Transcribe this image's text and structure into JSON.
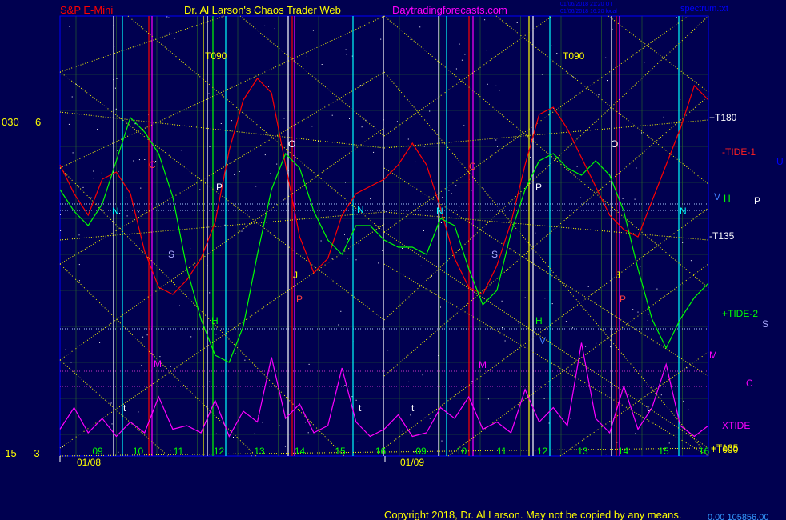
{
  "header": {
    "symbol": "S&P E-Mini",
    "title": "Dr. Al Larson's Chaos Trader Web",
    "site": "Daytradingforecasts.com",
    "stamp1": "01/06/2018 21:20 UT",
    "stamp2": "01/06/2018 16:20 local",
    "file": "spectrum.txt"
  },
  "footer": {
    "copyright": "Copyright 2018, Dr. Al Larson. May not be copied by any means.",
    "readout": "0.00 105856.00"
  },
  "left_scale": {
    "top": [
      "030",
      "6"
    ],
    "bottom": [
      "-15",
      "-3"
    ]
  },
  "colors": {
    "bg": "#000050",
    "plot_border": "#0000ff",
    "yellow": "#ffff00",
    "red": "#ff0000",
    "green": "#00ff00",
    "magenta": "#ff00ff",
    "cyan": "#00ffff",
    "white": "#ffffff"
  },
  "chart_data": {
    "type": "line",
    "x": {
      "sessions": [
        "01/08",
        "01/09"
      ],
      "hour_ticks": [
        "09",
        "10",
        "11",
        "12",
        "13",
        "14",
        "15",
        "16",
        "09",
        "10",
        "11",
        "12",
        "13",
        "14",
        "15",
        "16"
      ]
    },
    "series": [
      {
        "name": "-TIDE-1",
        "color": "#ff0000",
        "values": [
          0.3,
          0.1,
          -0.05,
          0.2,
          0.25,
          0.1,
          -0.3,
          -0.55,
          -0.6,
          -0.5,
          -0.35,
          -0.1,
          0.4,
          0.75,
          0.9,
          0.8,
          0.3,
          -0.2,
          -0.45,
          -0.35,
          -0.05,
          0.1,
          0.15,
          0.2,
          0.3,
          0.45,
          0.3,
          0.0,
          -0.35,
          -0.55,
          -0.6,
          -0.4,
          -0.1,
          0.3,
          0.65,
          0.7,
          0.55,
          0.35,
          0.15,
          -0.05,
          -0.15,
          -0.2,
          0.05,
          0.3,
          0.55,
          0.85,
          0.75
        ]
      },
      {
        "name": "+TIDE-2",
        "color": "#00ff00",
        "values": [
          0.35,
          0.2,
          0.1,
          0.25,
          0.55,
          0.85,
          0.75,
          0.6,
          0.3,
          -0.2,
          -0.55,
          -0.8,
          -0.85,
          -0.6,
          -0.1,
          0.35,
          0.6,
          0.5,
          0.2,
          0.0,
          -0.1,
          0.1,
          0.1,
          0.0,
          -0.05,
          -0.05,
          -0.1,
          0.15,
          0.1,
          -0.2,
          -0.45,
          -0.35,
          0.05,
          0.35,
          0.55,
          0.6,
          0.5,
          0.45,
          0.55,
          0.45,
          0.2,
          -0.2,
          -0.55,
          -0.75,
          -0.55,
          -0.4,
          -0.3
        ]
      },
      {
        "name": "XTIDE",
        "color": "#ff00ff",
        "values": [
          0.3,
          0.9,
          0.2,
          0.6,
          0.1,
          0.5,
          0.2,
          1.2,
          0.3,
          0.4,
          0.2,
          1.1,
          0.1,
          0.8,
          0.5,
          2.3,
          0.6,
          1.0,
          0.2,
          0.4,
          2.0,
          0.5,
          0.1,
          0.3,
          0.7,
          0.1,
          0.2,
          0.9,
          0.6,
          1.2,
          0.3,
          0.5,
          0.2,
          1.4,
          0.5,
          0.9,
          0.4,
          2.7,
          0.6,
          0.2,
          1.5,
          0.3,
          0.9,
          2.1,
          0.4,
          0.1,
          0.4
        ]
      }
    ],
    "flux_labels": [
      "T090",
      "T090",
      "+T180",
      "-T135",
      "+T135",
      "-T135",
      "+T090",
      "-TIDE-1",
      "+TIDE-2",
      "XTIDE",
      "H",
      "M"
    ],
    "planet_labels_day1": [
      "C",
      "P",
      "O",
      "N",
      "N",
      "S",
      "H",
      "M",
      "J",
      "P",
      "t",
      "t"
    ],
    "planet_labels_day2": [
      "C",
      "P",
      "O",
      "N",
      "N",
      "S",
      "H",
      "M",
      "J",
      "P",
      "t",
      "t",
      "V",
      "V"
    ],
    "right_labels": [
      "U",
      "P",
      "S",
      "C"
    ]
  }
}
